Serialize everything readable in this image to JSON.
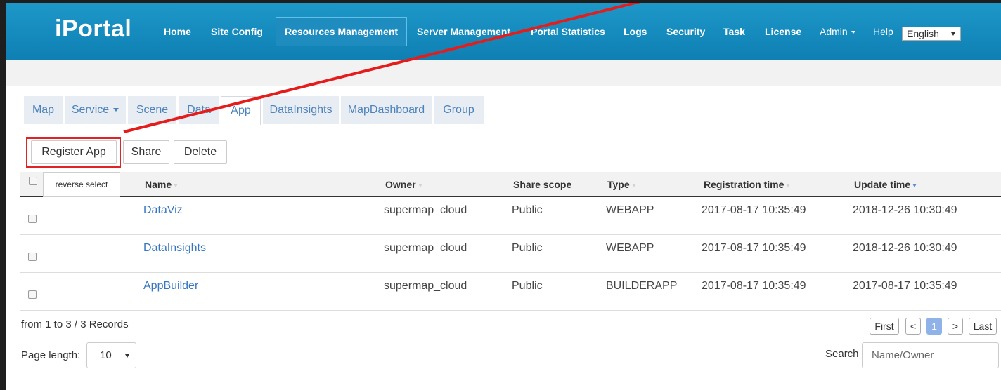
{
  "header": {
    "logo": "iPortal",
    "nav": [
      {
        "label": "Home"
      },
      {
        "label": "Site Config"
      },
      {
        "label": "Resources Management",
        "active": true
      },
      {
        "label": "Server Management"
      },
      {
        "label": "Portal Statistics"
      },
      {
        "label": "Logs"
      },
      {
        "label": "Security"
      },
      {
        "label": "Task"
      },
      {
        "label": "License"
      }
    ],
    "admin": "Admin",
    "help": "Help",
    "language": "English"
  },
  "tabs": [
    {
      "label": "Map"
    },
    {
      "label": "Service"
    },
    {
      "label": "Scene"
    },
    {
      "label": "Data"
    },
    {
      "label": "App",
      "active": true
    },
    {
      "label": "DataInsights"
    },
    {
      "label": "MapDashboard"
    },
    {
      "label": "Group"
    }
  ],
  "actions": {
    "register": "Register App",
    "share": "Share",
    "delete": "Delete"
  },
  "table": {
    "reverse_select": "reverse select",
    "columns": [
      "Name",
      "Owner",
      "Share scope",
      "Type",
      "Registration time",
      "Update time"
    ],
    "rows": [
      {
        "name": "DataViz",
        "owner": "supermap_cloud",
        "share_scope": "Public",
        "type": "WEBAPP",
        "registration_time": "2017-08-17 10:35:49",
        "update_time": "2018-12-26 10:30:49"
      },
      {
        "name": "DataInsights",
        "owner": "supermap_cloud",
        "share_scope": "Public",
        "type": "WEBAPP",
        "registration_time": "2017-08-17 10:35:49",
        "update_time": "2018-12-26 10:30:49"
      },
      {
        "name": "AppBuilder",
        "owner": "supermap_cloud",
        "share_scope": "Public",
        "type": "BUILDERAPP",
        "registration_time": "2017-08-17 10:35:49",
        "update_time": "2017-08-17 10:35:49"
      }
    ]
  },
  "footer": {
    "records": "from 1 to 3 / 3 Records",
    "pagination": {
      "first": "First",
      "prev": "<",
      "current": "1",
      "next": ">",
      "last": "Last"
    },
    "page_length_label": "Page length:",
    "page_length": "10",
    "search_label": "Search",
    "search_placeholder": "Name/Owner"
  },
  "colors": {
    "header": "#1a8fc2",
    "link": "#3677c0",
    "highlight": "#e02424",
    "active_page": "#8fb2e8"
  }
}
